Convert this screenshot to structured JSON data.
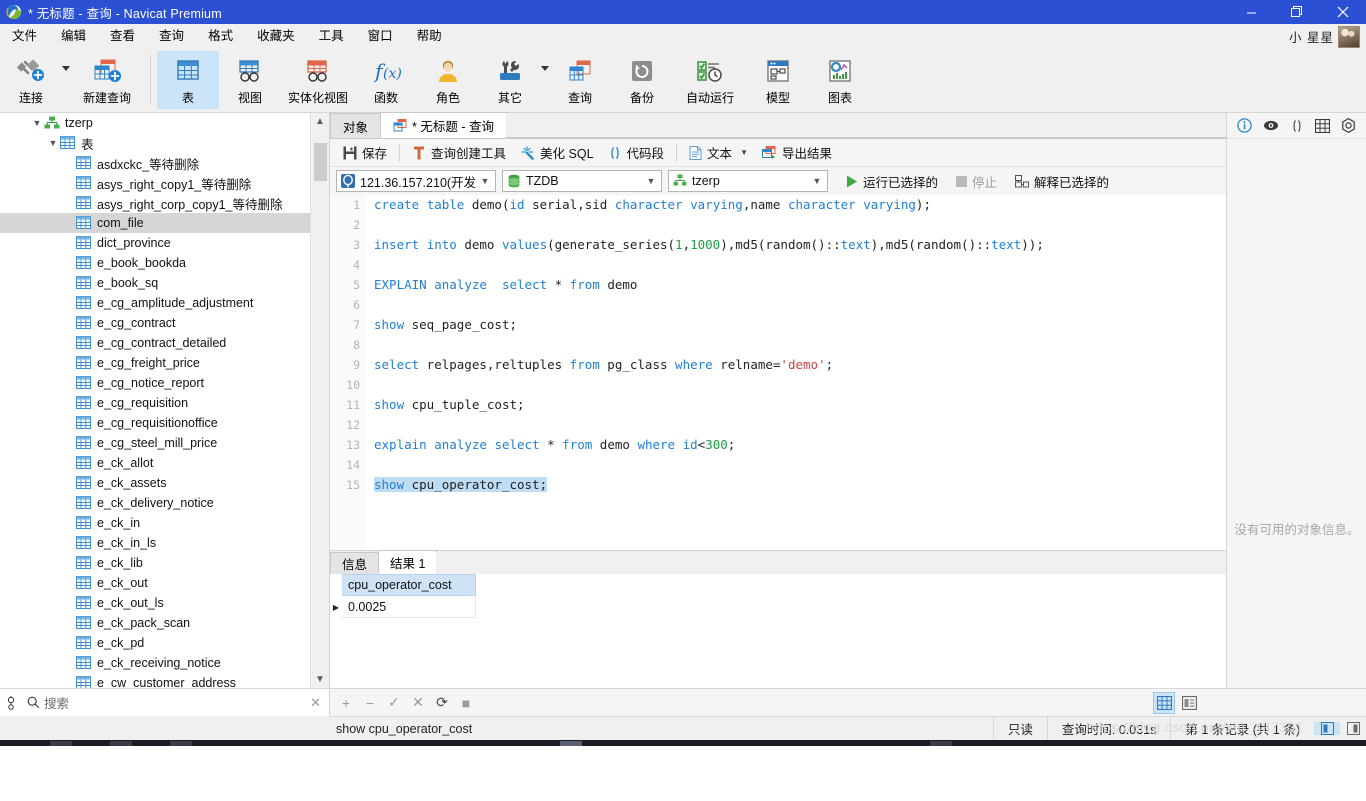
{
  "window": {
    "title": "* 无标题 - 查询 - Navicat Premium",
    "minimize": "—",
    "maximize": "❐",
    "close": "✕"
  },
  "menu": {
    "items": [
      {
        "label": "文件"
      },
      {
        "label": "编辑"
      },
      {
        "label": "查看"
      },
      {
        "label": "查询"
      },
      {
        "label": "格式"
      },
      {
        "label": "收藏夹"
      },
      {
        "label": "工具"
      },
      {
        "label": "窗口"
      },
      {
        "label": "帮助"
      }
    ],
    "user": "小 星星"
  },
  "toolbar": {
    "items": [
      {
        "label": "连接",
        "icon": "connection-icon",
        "dropdown": true
      },
      {
        "label": "新建查询",
        "icon": "new-query-icon",
        "dropdown": false
      },
      {
        "label": "表",
        "icon": "table-icon",
        "active": true
      },
      {
        "label": "视图",
        "icon": "view-icon"
      },
      {
        "label": "实体化视图",
        "icon": "materialized-view-icon"
      },
      {
        "label": "函数",
        "icon": "function-icon"
      },
      {
        "label": "角色",
        "icon": "role-icon"
      },
      {
        "label": "其它",
        "icon": "other-icon",
        "dropdown": true
      },
      {
        "label": "查询",
        "icon": "query-icon"
      },
      {
        "label": "备份",
        "icon": "backup-icon"
      },
      {
        "label": "自动运行",
        "icon": "automation-icon"
      },
      {
        "label": "模型",
        "icon": "model-icon"
      },
      {
        "label": "图表",
        "icon": "chart-icon"
      }
    ]
  },
  "sidebar": {
    "root": {
      "label": "tzerp",
      "icon": "database-icon",
      "expanded": true
    },
    "group": {
      "label": "表",
      "icon": "table-folder-icon",
      "expanded": true
    },
    "tables": [
      {
        "label": "asdxckc_等待删除"
      },
      {
        "label": "asys_right_copy1_等待删除"
      },
      {
        "label": "asys_right_corp_copy1_等待删除"
      },
      {
        "label": "com_file",
        "selected": true
      },
      {
        "label": "dict_province"
      },
      {
        "label": "e_book_bookda"
      },
      {
        "label": "e_book_sq"
      },
      {
        "label": "e_cg_amplitude_adjustment"
      },
      {
        "label": "e_cg_contract"
      },
      {
        "label": "e_cg_contract_detailed"
      },
      {
        "label": "e_cg_freight_price"
      },
      {
        "label": "e_cg_notice_report"
      },
      {
        "label": "e_cg_requisition"
      },
      {
        "label": "e_cg_requisitionoffice"
      },
      {
        "label": "e_cg_steel_mill_price"
      },
      {
        "label": "e_ck_allot"
      },
      {
        "label": "e_ck_assets"
      },
      {
        "label": "e_ck_delivery_notice"
      },
      {
        "label": "e_ck_in"
      },
      {
        "label": "e_ck_in_ls"
      },
      {
        "label": "e_ck_lib"
      },
      {
        "label": "e_ck_out"
      },
      {
        "label": "e_ck_out_ls"
      },
      {
        "label": "e_ck_pack_scan"
      },
      {
        "label": "e_ck_pd"
      },
      {
        "label": "e_ck_receiving_notice"
      },
      {
        "label": "e_cw_customer_address"
      }
    ],
    "search": {
      "placeholder": "搜索",
      "clear": "✕"
    }
  },
  "tabs": {
    "objects": "对象",
    "query": "* 无标题 - 查询"
  },
  "querybar": {
    "save": "保存",
    "query_builder": "查询创建工具",
    "beautify_sql": "美化 SQL",
    "snippet": "代码段",
    "text": "文本",
    "export_result": "导出结果"
  },
  "connection": {
    "server": "121.36.157.210(开发",
    "database": "TZDB",
    "schema": "tzerp",
    "run_selected": "运行已选择的",
    "stop": "停止",
    "explain_selected": "解释已选择的"
  },
  "editor": {
    "lines": [
      {
        "n": "1",
        "tokens": [
          {
            "t": "create",
            "c": "kw"
          },
          {
            "t": " ",
            "c": ""
          },
          {
            "t": "table",
            "c": "kw"
          },
          {
            "t": " demo(",
            "c": ""
          },
          {
            "t": "id",
            "c": "kw"
          },
          {
            "t": " serial,sid ",
            "c": ""
          },
          {
            "t": "character",
            "c": "kw"
          },
          {
            "t": " ",
            "c": ""
          },
          {
            "t": "varying",
            "c": "kw"
          },
          {
            "t": ",name ",
            "c": ""
          },
          {
            "t": "character",
            "c": "kw"
          },
          {
            "t": " ",
            "c": ""
          },
          {
            "t": "varying",
            "c": "kw"
          },
          {
            "t": ");",
            "c": ""
          }
        ]
      },
      {
        "n": "2",
        "tokens": []
      },
      {
        "n": "3",
        "tokens": [
          {
            "t": "insert",
            "c": "kw"
          },
          {
            "t": " ",
            "c": ""
          },
          {
            "t": "into",
            "c": "kw"
          },
          {
            "t": " demo ",
            "c": ""
          },
          {
            "t": "values",
            "c": "kw"
          },
          {
            "t": "(generate_series(",
            "c": ""
          },
          {
            "t": "1",
            "c": "num"
          },
          {
            "t": ",",
            "c": ""
          },
          {
            "t": "1000",
            "c": "num"
          },
          {
            "t": "),md5(random()::",
            "c": ""
          },
          {
            "t": "text",
            "c": "kw"
          },
          {
            "t": "),md5(random()::",
            "c": ""
          },
          {
            "t": "text",
            "c": "kw"
          },
          {
            "t": "));",
            "c": ""
          }
        ]
      },
      {
        "n": "4",
        "tokens": []
      },
      {
        "n": "5",
        "tokens": [
          {
            "t": "EXPLAIN",
            "c": "kw"
          },
          {
            "t": " ",
            "c": ""
          },
          {
            "t": "analyze",
            "c": "kw"
          },
          {
            "t": "  ",
            "c": ""
          },
          {
            "t": "select",
            "c": "kw"
          },
          {
            "t": " * ",
            "c": ""
          },
          {
            "t": "from",
            "c": "kw"
          },
          {
            "t": " demo",
            "c": ""
          }
        ]
      },
      {
        "n": "6",
        "tokens": []
      },
      {
        "n": "7",
        "tokens": [
          {
            "t": "show",
            "c": "kw"
          },
          {
            "t": " seq_page_cost;",
            "c": ""
          }
        ]
      },
      {
        "n": "8",
        "tokens": []
      },
      {
        "n": "9",
        "tokens": [
          {
            "t": "select",
            "c": "kw"
          },
          {
            "t": " relpages,reltuples ",
            "c": ""
          },
          {
            "t": "from",
            "c": "kw"
          },
          {
            "t": " pg_class ",
            "c": ""
          },
          {
            "t": "where",
            "c": "kw"
          },
          {
            "t": " relname=",
            "c": ""
          },
          {
            "t": "'demo'",
            "c": "str"
          },
          {
            "t": ";",
            "c": ""
          }
        ]
      },
      {
        "n": "10",
        "tokens": []
      },
      {
        "n": "11",
        "tokens": [
          {
            "t": "show",
            "c": "kw"
          },
          {
            "t": " cpu_tuple_cost;",
            "c": ""
          }
        ]
      },
      {
        "n": "12",
        "tokens": []
      },
      {
        "n": "13",
        "tokens": [
          {
            "t": "explain",
            "c": "kw"
          },
          {
            "t": " ",
            "c": ""
          },
          {
            "t": "analyze",
            "c": "kw"
          },
          {
            "t": " ",
            "c": ""
          },
          {
            "t": "select",
            "c": "kw"
          },
          {
            "t": " * ",
            "c": ""
          },
          {
            "t": "from",
            "c": "kw"
          },
          {
            "t": " demo ",
            "c": ""
          },
          {
            "t": "where",
            "c": "kw"
          },
          {
            "t": " ",
            "c": ""
          },
          {
            "t": "id",
            "c": "kw"
          },
          {
            "t": "<",
            "c": ""
          },
          {
            "t": "300",
            "c": "num"
          },
          {
            "t": ";",
            "c": ""
          }
        ]
      },
      {
        "n": "14",
        "tokens": []
      },
      {
        "n": "15",
        "tokens": [
          {
            "t": "show",
            "c": "kw",
            "h": true
          },
          {
            "t": " cpu_operator_cost;",
            "c": "",
            "h": true
          }
        ]
      }
    ]
  },
  "results": {
    "tabs": [
      {
        "label": "信息",
        "active": false
      },
      {
        "label": "结果 1",
        "active": true
      }
    ],
    "columns": [
      "cpu_operator_cost"
    ],
    "rows": [
      [
        "0.0025"
      ]
    ]
  },
  "gridbar": {
    "add": "+",
    "remove": "−",
    "confirm": "✓",
    "cancel": "✕",
    "refresh": "⟳",
    "stop": "■",
    "view_grid": "grid-view-icon",
    "view_form": "form-view-icon"
  },
  "statusbar": {
    "sql": "show cpu_operator_cost",
    "readonly": "只读",
    "query_time": "查询时间: 0.031s",
    "record_info": "第 1 条记录 (共 1 条)",
    "page_first": "◧",
    "page_next": "◨"
  },
  "infopane": {
    "icons": [
      "info-icon",
      "eye-icon",
      "parentheses-icon",
      "table-grid-icon",
      "settings-icon"
    ],
    "message": "没有可用的对象信息。"
  },
  "watermark": "https://blog.csdn.net/xin_437301",
  "colors": {
    "titlebar": "#2b50d4",
    "accent": "#1f7fd4",
    "selection": "#cce4f7",
    "keyword": "#1f7fd4",
    "number": "#1e9c42",
    "string": "#d43f3f"
  }
}
